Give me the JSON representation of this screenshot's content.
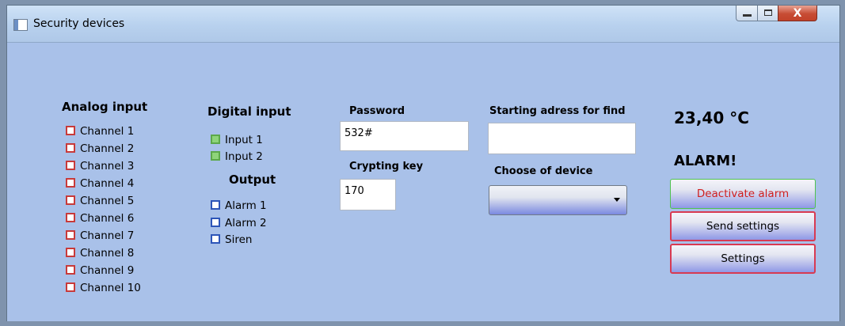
{
  "window": {
    "title": "Security devices"
  },
  "analog": {
    "heading": "Analog input",
    "channels": [
      "Channel 1",
      "Channel 2",
      "Channel 3",
      "Channel 4",
      "Channel 5",
      "Channel 6",
      "Channel 7",
      "Channel 8",
      "Channel 9",
      "Channel 10"
    ]
  },
  "digital": {
    "heading": "Digital input",
    "inputs": [
      "Input 1",
      "Input 2"
    ],
    "output_heading": "Output",
    "outputs": [
      "Alarm 1",
      "Alarm 2",
      "Siren"
    ]
  },
  "password": {
    "label": "Password",
    "value": "532#"
  },
  "crypting": {
    "label": "Crypting key",
    "value": "170"
  },
  "starting": {
    "label": "Starting adress for find",
    "value": ""
  },
  "device": {
    "label": "Choose of device",
    "selected": ""
  },
  "status": {
    "temperature": "23,40 °C",
    "alarm": "ALARM!"
  },
  "buttons": {
    "deactivate": "Deactivate alarm",
    "send": "Send settings",
    "settings": "Settings"
  },
  "colors": {
    "background": "#a9c1e9",
    "alarm_text": "#d02020"
  }
}
